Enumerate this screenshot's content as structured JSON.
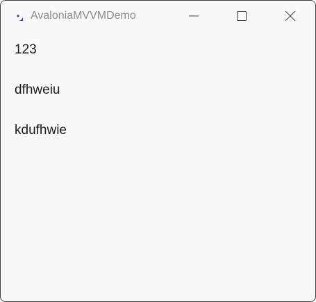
{
  "window": {
    "title": "AvaloniaMVVMDemo",
    "icon": "avalonia-logo-icon",
    "controls": {
      "minimize": "minimize-icon",
      "maximize": "maximize-icon",
      "close": "close-icon"
    }
  },
  "content": {
    "items": [
      {
        "text": "123"
      },
      {
        "text": "dfhweiu"
      },
      {
        "text": "kdufhwie"
      }
    ]
  },
  "colors": {
    "background": "#f9f9f9",
    "title_text": "#8a8a8a",
    "body_text": "#1a1a1a",
    "accent": "#7b3fb0"
  }
}
